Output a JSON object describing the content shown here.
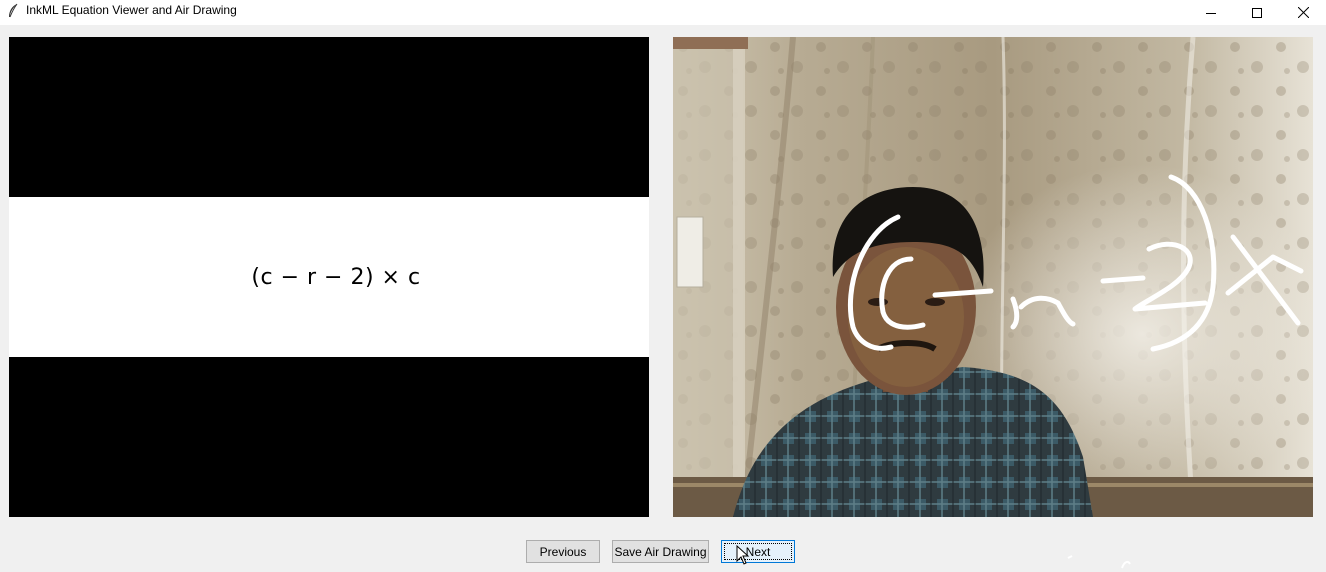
{
  "window": {
    "title": "InkML Equation Viewer and Air Drawing",
    "icon": "feather-icon",
    "controls": [
      "minimize-icon",
      "maximize-icon",
      "close-icon"
    ]
  },
  "equation_panel": {
    "equation": "(c − r − 2) × c",
    "background_color": "#000000",
    "band_color": "#ffffff"
  },
  "camera_panel": {
    "content": "webcam feed with air drawing overlay",
    "stroke_color": "#ffffff"
  },
  "buttons": {
    "previous": "Previous",
    "save": "Save Air Drawing",
    "next": "Next"
  },
  "colors": {
    "window_bg": "#f0f0f0",
    "button_bg": "#e1e1e1",
    "button_border": "#adadad",
    "focus_border": "#0078d7"
  }
}
